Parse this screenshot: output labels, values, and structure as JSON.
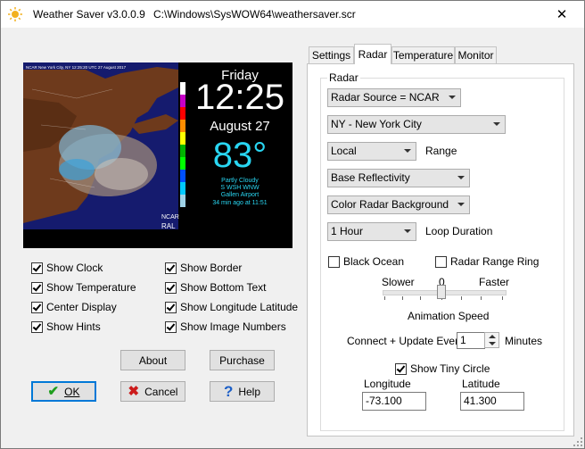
{
  "window": {
    "title": "Weather Saver v3.0.0.9",
    "path": "C:\\Windows\\SysWOW64\\weathersaver.scr",
    "close_glyph": "✕"
  },
  "preview": {
    "radar_header": "NCAR New York City, NY  12:25:20 UTC 27 August 2017",
    "day": "Friday",
    "time": "12:25",
    "date": "August 27",
    "temperature": "83°",
    "condition": "Partly Cloudy",
    "wind": "S WSH WNW",
    "location": "Gallen Airport",
    "updated": "34 min ago at 11:51",
    "radar_source_tag": "NCAR",
    "radar_id_tag": "RAL"
  },
  "options": {
    "left": [
      {
        "label": "Show Clock",
        "checked": true
      },
      {
        "label": "Show Temperature",
        "checked": true
      },
      {
        "label": "Center Display",
        "checked": true
      },
      {
        "label": "Show Hints",
        "checked": true
      }
    ],
    "right": [
      {
        "label": "Show Border",
        "checked": true
      },
      {
        "label": "Show Bottom Text",
        "checked": true
      },
      {
        "label": "Show Longitude Latitude",
        "checked": true
      },
      {
        "label": "Show Image Numbers",
        "checked": true
      }
    ]
  },
  "buttons": {
    "about": "About",
    "purchase": "Purchase",
    "ok": "OK",
    "cancel": "Cancel",
    "help": "Help"
  },
  "tabs": [
    {
      "label": "Settings",
      "active": false
    },
    {
      "label": "Radar",
      "active": true
    },
    {
      "label": "Temperature",
      "active": false
    },
    {
      "label": "Monitor",
      "active": false
    }
  ],
  "radar": {
    "group_label": "Radar",
    "source": "Radar Source = NCAR",
    "station": "NY - New York City",
    "range_value": "Local",
    "range_label": "Range",
    "product": "Base Reflectivity",
    "background": "Color Radar Background",
    "loop_value": "1 Hour",
    "loop_label": "Loop Duration",
    "black_ocean": {
      "label": "Black Ocean",
      "checked": false
    },
    "range_ring": {
      "label": "Radar Range Ring",
      "checked": false
    },
    "slider": {
      "slower": "Slower",
      "zero": "0",
      "faster": "Faster",
      "caption": "Animation Speed",
      "value": 0
    },
    "update_prefix": "Connect + Update Every",
    "update_value": "1",
    "update_unit": "Minutes",
    "tiny_circle": {
      "label": "Show Tiny Circle",
      "checked": true
    },
    "longitude_label": "Longitude",
    "longitude_value": "-73.100",
    "latitude_label": "Latitude",
    "latitude_value": "41.300"
  },
  "colors": {
    "accent": "#0078d7",
    "temperature": "#29d6f2",
    "ok_check": "#1e9e1e",
    "cancel_x": "#cc1b1b",
    "help_q": "#1c5fc7"
  }
}
